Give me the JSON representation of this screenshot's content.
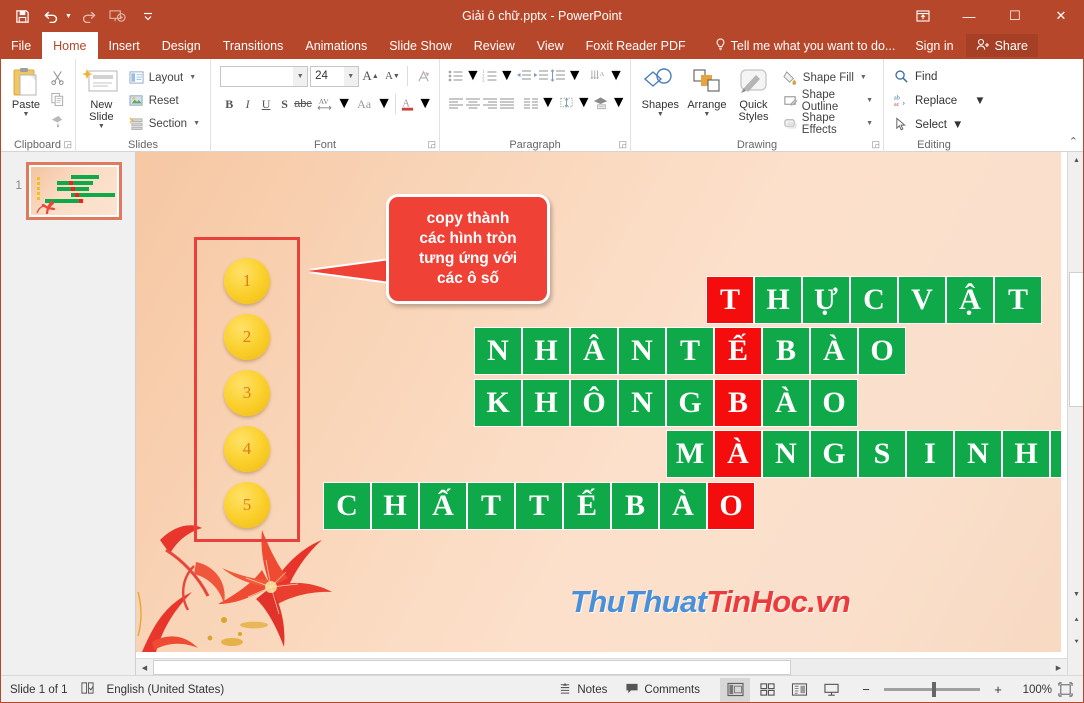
{
  "titlebar": {
    "document_title": "Giải ô chữ.pptx - PowerPoint",
    "quick_access": [
      {
        "name": "save-icon",
        "label": "Save"
      },
      {
        "name": "undo-icon",
        "label": "Undo"
      },
      {
        "name": "redo-icon",
        "label": "Redo"
      },
      {
        "name": "start-presentation-icon",
        "label": "Start From Beginning"
      },
      {
        "name": "customize-qat-icon",
        "label": "Customize Quick Access Toolbar"
      }
    ],
    "window_controls": {
      "ribbon_display_options": "▣",
      "minimize": "—",
      "maximize": "☐",
      "close": "✕"
    }
  },
  "tabs": [
    {
      "label": "File",
      "active": false
    },
    {
      "label": "Home",
      "active": true
    },
    {
      "label": "Insert",
      "active": false
    },
    {
      "label": "Design",
      "active": false
    },
    {
      "label": "Transitions",
      "active": false
    },
    {
      "label": "Animations",
      "active": false
    },
    {
      "label": "Slide Show",
      "active": false
    },
    {
      "label": "Review",
      "active": false
    },
    {
      "label": "View",
      "active": false
    },
    {
      "label": "Foxit Reader PDF",
      "active": false
    }
  ],
  "tellme": {
    "label": "Tell me what you want to do...",
    "icon": "lightbulb-icon"
  },
  "signin": {
    "label": "Sign in"
  },
  "share": {
    "label": "Share",
    "icon": "share-person-icon"
  },
  "ribbon": {
    "groups": [
      {
        "name": "Clipboard",
        "label": "Clipboard",
        "paste": "Paste",
        "items": [
          "Cut",
          "Copy",
          "Format Painter"
        ]
      },
      {
        "name": "Slides",
        "label": "Slides",
        "new_slide": "New\nSlide",
        "items": [
          "Layout",
          "Reset",
          "Section"
        ]
      },
      {
        "name": "Font",
        "label": "Font",
        "font_name_value": "",
        "font_name_placeholder": "",
        "font_size_value": "24",
        "buttons": [
          "Bold",
          "Italic",
          "Underline",
          "Text Shadow",
          "Strikethrough",
          "Character Spacing",
          "Change Case",
          "Font Color",
          "Increase Font Size",
          "Decrease Font Size",
          "Clear All Formatting"
        ]
      },
      {
        "name": "Paragraph",
        "label": "Paragraph",
        "buttons": [
          "Bullets",
          "Numbering",
          "Decrease List Level",
          "Increase List Level",
          "Line Spacing",
          "Align Left",
          "Center",
          "Align Right",
          "Justify",
          "Columns",
          "Text Direction",
          "Align Text",
          "Convert to SmartArt"
        ]
      },
      {
        "name": "Drawing",
        "label": "Drawing",
        "shapes": "Shapes",
        "arrange": "Arrange",
        "quick_styles": "Quick\nStyles",
        "shape_fill": "Shape Fill",
        "shape_outline": "Shape Outline",
        "shape_effects": "Shape Effects"
      },
      {
        "name": "Editing",
        "label": "Editing",
        "find": "Find",
        "replace": "Replace",
        "select": "Select"
      }
    ],
    "collapse_label": "⌃"
  },
  "thumbnails": {
    "slides": [
      {
        "number": "1"
      }
    ]
  },
  "slide": {
    "numbers_box": {
      "circles": [
        "1",
        "2",
        "3",
        "4",
        "5"
      ]
    },
    "callout": {
      "text": "copy thành\ncác hình tròn\ntưng ứng với\ncác ô số",
      "fill_color": "#ef4136",
      "text_color": "#ffffff"
    },
    "watermark": {
      "part1": "ThuThuat",
      "part2": "TinHoc.vn",
      "color1": "#4a90d9",
      "color2": "#ec3b3b"
    },
    "crossword": {
      "cell_size": 48,
      "green": "#0fa94a",
      "red": "#f50d0d",
      "rows": [
        {
          "row": 1,
          "col_start": 8,
          "cells": [
            {
              "ch": "T",
              "red": true
            },
            {
              "ch": "H",
              "red": false
            },
            {
              "ch": "Ự",
              "red": false
            },
            {
              "ch": "C",
              "red": false
            },
            {
              "ch": "V",
              "red": false
            },
            {
              "ch": "Ậ",
              "red": false
            },
            {
              "ch": "T",
              "red": false
            }
          ]
        },
        {
          "row": 2,
          "col_start": 3,
          "cells": [
            {
              "ch": "N",
              "red": false
            },
            {
              "ch": "H",
              "red": false
            },
            {
              "ch": "Â",
              "red": false
            },
            {
              "ch": "N",
              "red": false
            },
            {
              "ch": "T",
              "red": false
            },
            {
              "ch": "Ế",
              "red": true
            },
            {
              "ch": "B",
              "red": false
            },
            {
              "ch": "À",
              "red": false
            },
            {
              "ch": "O",
              "red": false
            }
          ]
        },
        {
          "row": 3,
          "col_start": 3,
          "cells": [
            {
              "ch": "K",
              "red": false
            },
            {
              "ch": "H",
              "red": false
            },
            {
              "ch": "Ô",
              "red": false
            },
            {
              "ch": "N",
              "red": false
            },
            {
              "ch": "G",
              "red": false
            },
            {
              "ch": "B",
              "red": true
            },
            {
              "ch": "À",
              "red": false
            },
            {
              "ch": "O",
              "red": false
            }
          ]
        },
        {
          "row": 4,
          "col_start": 7,
          "cells": [
            {
              "ch": "M",
              "red": false
            },
            {
              "ch": "À",
              "red": true
            },
            {
              "ch": "N",
              "red": false
            },
            {
              "ch": "G",
              "red": false
            },
            {
              "ch": "S",
              "red": false
            },
            {
              "ch": "I",
              "red": false
            },
            {
              "ch": "N",
              "red": false
            },
            {
              "ch": "H",
              "red": false
            },
            {
              "ch": "C",
              "red": false
            }
          ]
        },
        {
          "row": 5,
          "col_start": 0,
          "cells": [
            {
              "ch": "C",
              "red": false
            },
            {
              "ch": "H",
              "red": false
            },
            {
              "ch": "Ấ",
              "red": false
            },
            {
              "ch": "T",
              "red": false
            },
            {
              "ch": "T",
              "red": false
            },
            {
              "ch": "Ế",
              "red": false
            },
            {
              "ch": "B",
              "red": false
            },
            {
              "ch": "À",
              "red": false
            },
            {
              "ch": "O",
              "red": true
            }
          ]
        }
      ]
    }
  },
  "statusbar": {
    "slide_indicator": "Slide 1 of 1",
    "spellcheck_icon": "spellcheck-icon",
    "language": "English (United States)",
    "notes": "Notes",
    "comments": "Comments",
    "views": [
      {
        "name": "normal-view",
        "selected": true
      },
      {
        "name": "slide-sorter-view",
        "selected": false
      },
      {
        "name": "reading-view",
        "selected": false
      },
      {
        "name": "slideshow-view",
        "selected": false
      }
    ],
    "zoom_out": "−",
    "zoom_in": "+",
    "zoom_level": "100%",
    "fit_to_window": "fit-slide-icon"
  }
}
